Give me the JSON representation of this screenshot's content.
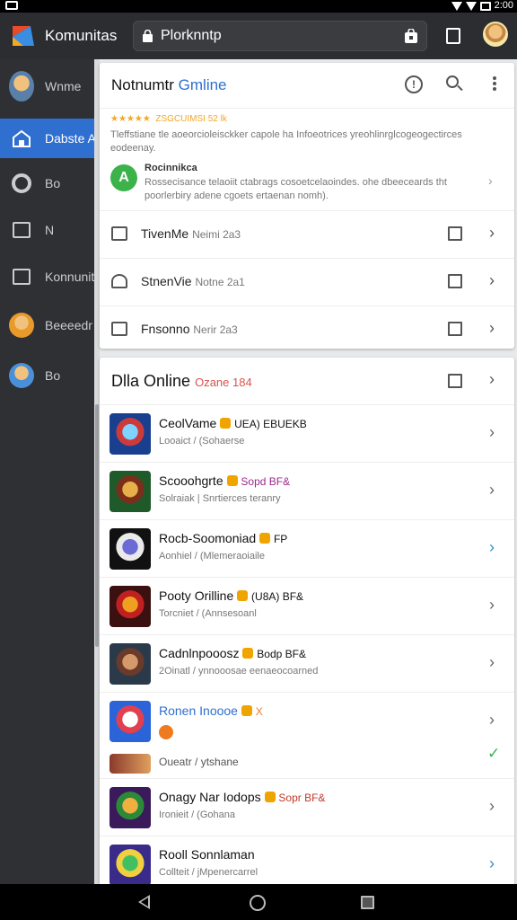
{
  "status_bar": {
    "time": "2:00"
  },
  "app_bar": {
    "title": "Komunitas",
    "url": "Plorknntp"
  },
  "sidebar": {
    "items": [
      {
        "label": "Wnme",
        "icon": "user-avatar-icon",
        "active": false
      },
      {
        "label": "Dabste A",
        "icon": "home-icon",
        "active": true
      },
      {
        "label": "Bo",
        "icon": "ring-icon",
        "active": false
      },
      {
        "label": "N",
        "icon": "inbox-icon",
        "active": false
      },
      {
        "label": "Konnunit",
        "icon": "folder-icon",
        "active": false
      },
      {
        "label": "Beeeedr",
        "icon": "user-avatar-icon",
        "active": false
      },
      {
        "label": "Bo",
        "icon": "user-avatar-icon",
        "active": false
      }
    ]
  },
  "card1": {
    "title_plain": "Notnumtr",
    "title_accent": "Gmline",
    "notice": {
      "stars": "★★★★★  ZSGCUIMSI 52 lk",
      "text": "Tleffstiane tle aoeorcioleisckker capole ha Infoeotrices yreohlinrglcogeogectirces eodeenay.",
      "badge": "A",
      "title": "Rocinnikca",
      "sub": "Rossecisance telaoiit ctabrags cosoetcelaoindes. ohe dbeeceards tht poorlerbiry adene cgoets ertaenan nomh).",
      "chevron": "›"
    },
    "rows": [
      {
        "name": "TivenMe",
        "meta": "Neimi 2a3"
      },
      {
        "name": "StnenVie",
        "meta": "Notne 2a1"
      },
      {
        "name": "Fnsonno",
        "meta": "Nerir 2a3"
      }
    ]
  },
  "card2": {
    "title_prefix": "Dlla",
    "title": "Online",
    "subtitle": "Ozane 184",
    "games": [
      {
        "title": "CeolVame",
        "tag": "UEA) EBUEKB",
        "meta": "Looaict / (Sohaerse",
        "colors": [
          "#1a3f8f",
          "#7fd3ff",
          "#cc3b3b"
        ],
        "chevron": "›",
        "chevron_style": "gray"
      },
      {
        "title": "Scooohgrte",
        "tag": "Sopd BF&",
        "meta": "Solraiak | Snrtierces teranry",
        "colors": [
          "#1e5a2a",
          "#e8b04a",
          "#7b2f1a"
        ],
        "chevron": "›",
        "chevron_style": "gray"
      },
      {
        "title": "Rocb-Soomoniad",
        "tag": "FP",
        "meta": "Aonhiel / (Mlemeraoiaile",
        "colors": [
          "#111111",
          "#6b6bd6",
          "#eaeaea"
        ],
        "chevron": "›",
        "chevron_style": "blue"
      },
      {
        "title": "Pooty Orilline",
        "tag": "(U8A) BF&",
        "meta": "Torcniet / (Annsesoanl",
        "colors": [
          "#3a1010",
          "#f0a020",
          "#c02020"
        ],
        "chevron": "›",
        "chevron_style": "gray"
      },
      {
        "title": "Cadnlnpooosz",
        "tag": "Bodp BF&",
        "meta": "2Oinatl / ynnooosae eenaeocoarned",
        "colors": [
          "#2a3a4a",
          "#d49a6a",
          "#6a3a2a"
        ],
        "chevron": "›",
        "chevron_style": "gray"
      },
      {
        "title": "Ronen Inoooe",
        "tag": "X",
        "meta": "",
        "colors": [
          "#2b63d9",
          "#ffffff",
          "#e04050"
        ],
        "chevron": "›",
        "chevron_style": "gray",
        "extra_title": "Oueatr / ytshane",
        "check": "✓"
      },
      {
        "title": "Onagy Nar Iodops",
        "tag": "Sopr BF&",
        "meta": "Ironieit / (Gohana",
        "colors": [
          "#3a1a5a",
          "#f0b040",
          "#2a8a3a"
        ],
        "chevron": "›",
        "chevron_style": "gray"
      },
      {
        "title": "Rooll Sonnlaman",
        "tag": "",
        "meta": "Collteit / jMpenercarrel",
        "colors": [
          "#3a2a8a",
          "#40c060",
          "#f0d040"
        ],
        "chevron": "›",
        "chevron_style": "blue"
      }
    ]
  },
  "navbar": {
    "back": "back",
    "home": "home",
    "recents": "recents"
  }
}
